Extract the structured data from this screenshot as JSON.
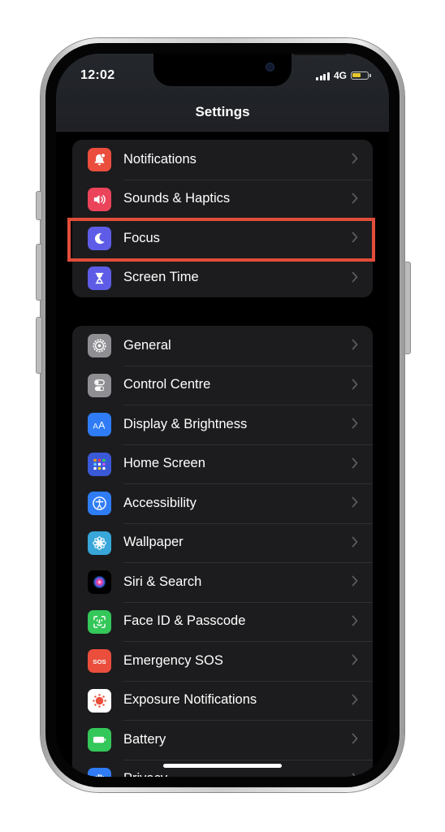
{
  "status_bar": {
    "time": "12:02",
    "network": "4G",
    "battery_level": 0.6
  },
  "header": {
    "title": "Settings"
  },
  "groups": [
    {
      "items": [
        {
          "label": "Notifications",
          "icon": "bell-icon",
          "color": "#eb4e3d"
        },
        {
          "label": "Sounds & Haptics",
          "icon": "speaker-icon",
          "color": "#eb445a"
        },
        {
          "label": "Focus",
          "icon": "moon-icon",
          "color": "#5e5ce6"
        },
        {
          "label": "Screen Time",
          "icon": "hourglass-icon",
          "color": "#5e5ce6"
        }
      ]
    },
    {
      "items": [
        {
          "label": "General",
          "icon": "gear-icon",
          "color": "#8e8e93"
        },
        {
          "label": "Control Centre",
          "icon": "toggles-icon",
          "color": "#8e8e93"
        },
        {
          "label": "Display & Brightness",
          "icon": "text-size-icon",
          "color": "#2f7cf6"
        },
        {
          "label": "Home Screen",
          "icon": "app-grid-icon",
          "color": "#3a59d6"
        },
        {
          "label": "Accessibility",
          "icon": "accessibility-icon",
          "color": "#2f7cf6"
        },
        {
          "label": "Wallpaper",
          "icon": "flower-icon",
          "color": "#38a6d8"
        },
        {
          "label": "Siri & Search",
          "icon": "siri-icon",
          "color": "#000000"
        },
        {
          "label": "Face ID & Passcode",
          "icon": "face-id-icon",
          "color": "#34c759"
        },
        {
          "label": "Emergency SOS",
          "icon": "sos-icon",
          "color": "#eb4e3d"
        },
        {
          "label": "Exposure Notifications",
          "icon": "exposure-icon",
          "color": "#ffffff"
        },
        {
          "label": "Battery",
          "icon": "battery-icon",
          "color": "#34c759"
        },
        {
          "label": "Privacy",
          "icon": "hand-icon",
          "color": "#2f7cf6"
        }
      ]
    }
  ],
  "icon_glyphs": {
    "sos_text": "SOS",
    "display_text": "AA"
  },
  "highlight_color": "#e14d3a"
}
